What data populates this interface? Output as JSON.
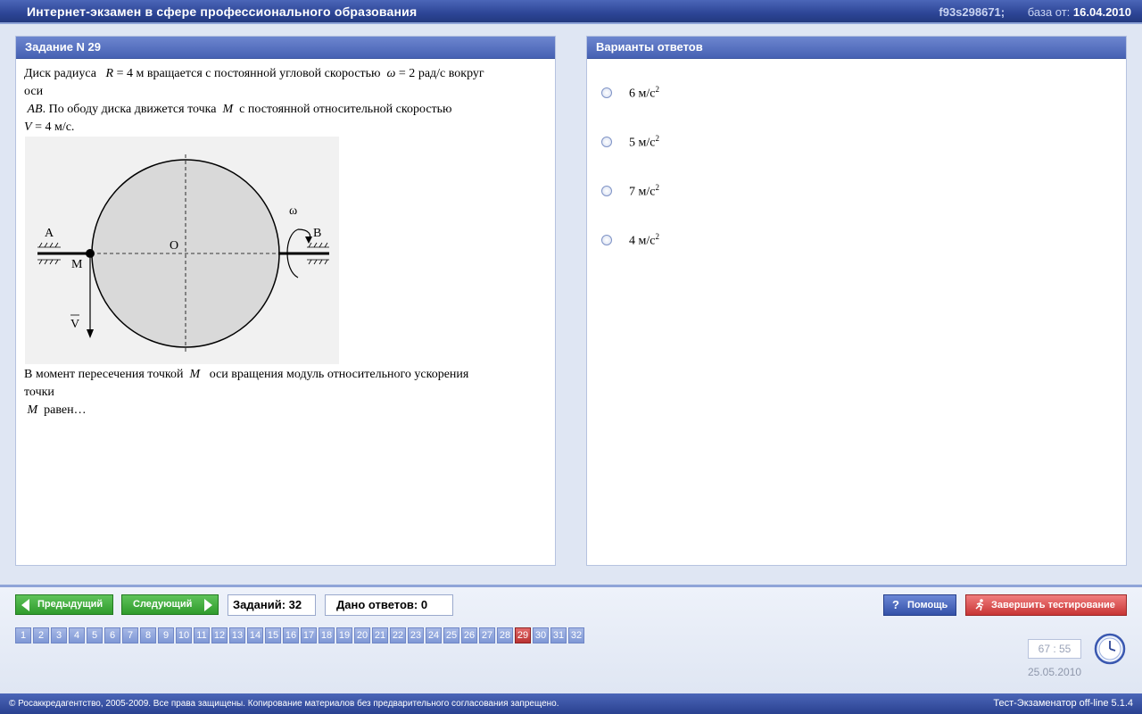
{
  "window": {
    "title": "Интернет-экзамен в сфере профессионального образования",
    "session_id": "f93s298671;",
    "db_label": "база от:",
    "db_date": "16.04.2010"
  },
  "task": {
    "header": "Задание N 29",
    "q_p1": "Диск радиуса",
    "q_R": "R",
    "q_R_eq": "= 4",
    "q_p2": "м вращается с постоянной угловой скоростью",
    "q_omega": "ω",
    "q_omega_eq": "= 2",
    "q_p3": "рад/с вокруг",
    "q_p4": "оси",
    "q_AB": "AB",
    "q_p5": ". По ободу диска движется точка",
    "q_M": "M",
    "q_p6": "с постоянной относительной скоростью",
    "q_V": "V",
    "q_V_eq": "= 4 м/с.",
    "q2_p1": "В  момент  пересечения точкой",
    "q2_M": "M",
    "q2_p2": "оси вращения модуль относительного ускорения",
    "q2_p3": "точки",
    "q2_M2": "M",
    "q2_p4": "равен…",
    "figure_labels": {
      "A": "A",
      "B": "B",
      "O": "O",
      "M": "M",
      "V": "V",
      "omega": "ω"
    }
  },
  "answers": {
    "header": "Варианты ответов",
    "options": [
      {
        "value": "6",
        "unit": "м/с",
        "exp": "2"
      },
      {
        "value": "5",
        "unit": "м/с",
        "exp": "2"
      },
      {
        "value": "7",
        "unit": "м/с",
        "exp": "2"
      },
      {
        "value": "4",
        "unit": "м/с",
        "exp": "2"
      }
    ]
  },
  "nav": {
    "prev_label": "Предыдущий",
    "next_label": "Следующий",
    "tasks_count": "Заданий: 32",
    "answered_count": "Дано ответов: 0",
    "help_label": "Помощь",
    "finish_label": "Завершить тестирование",
    "pages": [
      "1",
      "2",
      "3",
      "4",
      "5",
      "6",
      "7",
      "8",
      "9",
      "10",
      "11",
      "12",
      "13",
      "14",
      "15",
      "16",
      "17",
      "18",
      "19",
      "20",
      "21",
      "22",
      "23",
      "24",
      "25",
      "26",
      "27",
      "28",
      "29",
      "30",
      "31",
      "32"
    ],
    "current_page": "29"
  },
  "timer": {
    "value": "67 : 55",
    "date": "25.05.2010"
  },
  "footer": {
    "copyright": "© Росаккредагентство, 2005-2009. Все права защищены. Копирование материалов без предварительного согласования запрещено.",
    "version": "Тест-Экзаменатор off-line 5.1.4"
  },
  "colors": {
    "accent": "#4661b3",
    "page_active": "#b93232",
    "nav_button": "#2f9b2c",
    "finish_button": "#c83535"
  }
}
